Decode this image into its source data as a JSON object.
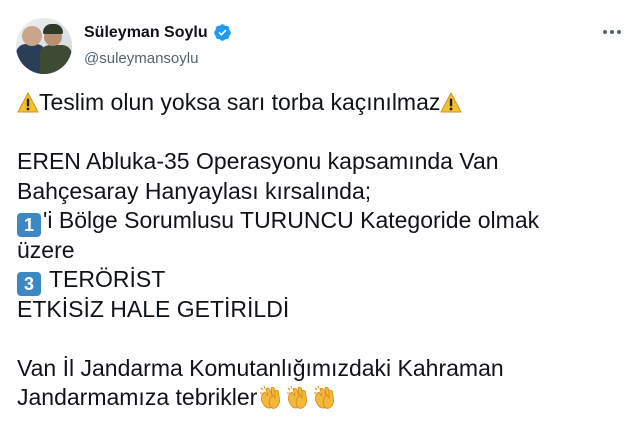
{
  "tweet": {
    "author_name": "Süleyman Soylu",
    "author_handle": "@suleymansoylu",
    "verified": true,
    "lines": [
      {
        "prefix_icon": "warning-icon",
        "text": "Teslim olun yoksa sarı torba kaçınılmaz",
        "suffix_icon": "warning-icon"
      },
      {
        "blank": true
      },
      {
        "text": "EREN Abluka-35 Operasyonu kapsamında Van"
      },
      {
        "text": "Bahçesaray Hanyaylası kırsalında;"
      },
      {
        "keycap": "1",
        "text": "'i Bölge Sorumlusu TURUNCU Kategoride olmak"
      },
      {
        "text": "üzere"
      },
      {
        "keycap": "3",
        "text": "TERÖRİST"
      },
      {
        "text": "ETKİSİZ HALE GETİRİLDİ"
      },
      {
        "blank": true
      },
      {
        "text": "Van İl Jandarma Komutanlığımızdaki Kahraman"
      },
      {
        "text": "Jandarmamıza tebrikler",
        "suffix_icons": [
          "clapping-hands-icon",
          "clapping-hands-icon",
          "clapping-hands-icon"
        ]
      }
    ]
  },
  "colors": {
    "text": "#0f1419",
    "secondary": "#536471",
    "verified_badge": "#1d9bf0",
    "keycap": "#3b88c3",
    "warning": "#f4c02b",
    "clap": "#f4b73a"
  }
}
